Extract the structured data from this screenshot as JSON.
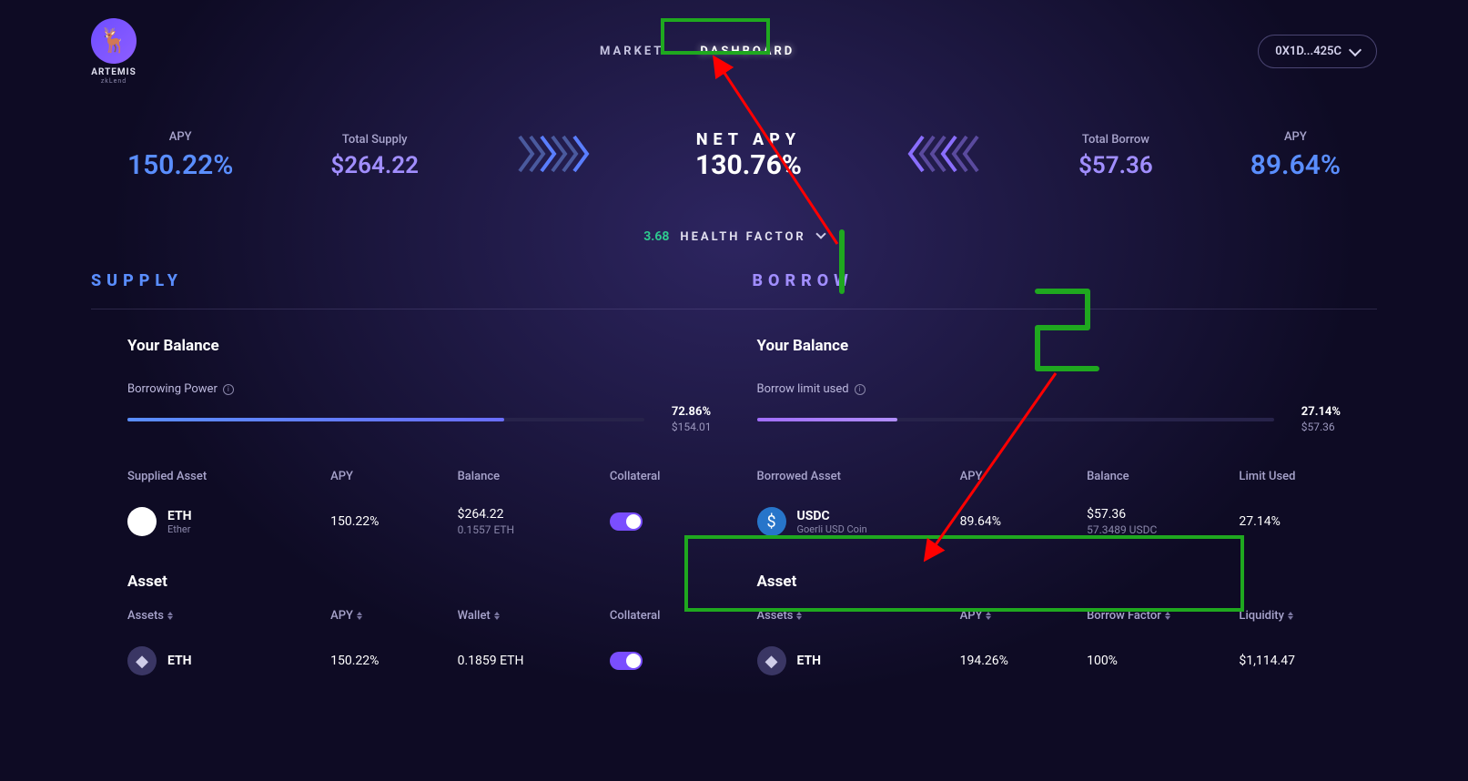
{
  "brand": {
    "name": "ARTEMIS",
    "sub": "zkLend"
  },
  "nav": {
    "market": "MARKET",
    "dashboard": "DASHBOARD"
  },
  "wallet": {
    "address": "0X1D...425C"
  },
  "stats": {
    "supply_apy_label": "APY",
    "supply_apy": "150.22%",
    "total_supply_label": "Total Supply",
    "total_supply": "$264.22",
    "net_apy_label": "NET APY",
    "net_apy": "130.76%",
    "total_borrow_label": "Total Borrow",
    "total_borrow": "$57.36",
    "borrow_apy_label": "APY",
    "borrow_apy": "89.64%",
    "health_value": "3.68",
    "health_label": "HEALTH FACTOR"
  },
  "sections": {
    "supply": "SUPPLY",
    "borrow": "BORROW"
  },
  "supply_panel": {
    "balance_title": "Your Balance",
    "prog_label": "Borrowing Power",
    "prog_pct": "72.86%",
    "prog_amt": "$154.01",
    "th1": "Supplied Asset",
    "th2": "APY",
    "th3": "Balance",
    "th4": "Collateral",
    "row": {
      "symbol": "ETH",
      "name": "Ether",
      "apy": "150.22%",
      "balance": "$264.22",
      "balance_sub": "0.1557 ETH"
    },
    "asset_title": "Asset",
    "at1": "Assets",
    "at2": "APY",
    "at3": "Wallet",
    "at4": "Collateral",
    "arow": {
      "symbol": "ETH",
      "apy": "150.22%",
      "wallet": "0.1859 ETH"
    }
  },
  "borrow_panel": {
    "balance_title": "Your Balance",
    "prog_label": "Borrow limit used",
    "prog_pct": "27.14%",
    "prog_amt": "$57.36",
    "th1": "Borrowed Asset",
    "th2": "APY",
    "th3": "Balance",
    "th4": "Limit Used",
    "row": {
      "symbol": "USDC",
      "name": "Goerli USD Coin",
      "apy": "89.64%",
      "balance": "$57.36",
      "balance_sub": "57.3489 USDC",
      "limit": "27.14%"
    },
    "asset_title": "Asset",
    "at1": "Assets",
    "at2": "APY",
    "at3": "Borrow Factor",
    "at4": "Liquidity",
    "arow": {
      "symbol": "ETH",
      "apy": "194.26%",
      "bf": "100%",
      "liq": "$1,114.47"
    }
  }
}
